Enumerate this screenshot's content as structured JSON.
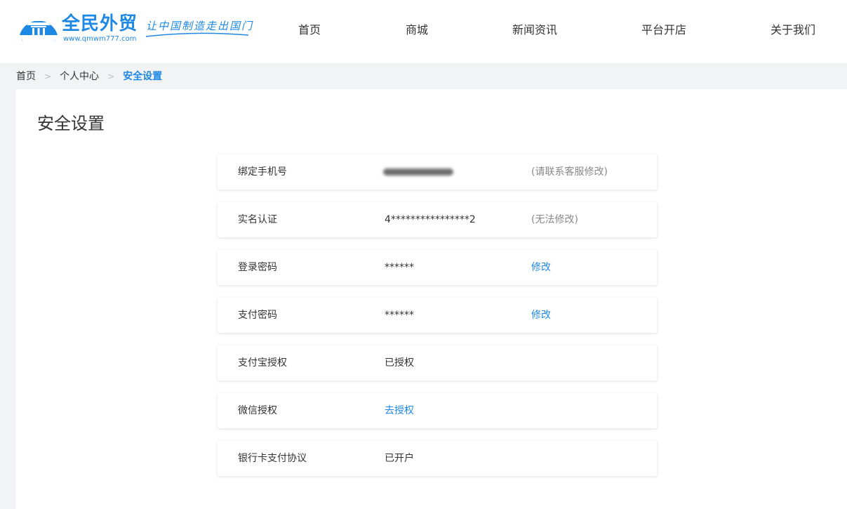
{
  "header": {
    "logo": {
      "title": "全民外贸",
      "url": "www.qmwm777.com",
      "slogan": "让中国制造走出国门"
    },
    "nav": [
      "首页",
      "商城",
      "新闻资讯",
      "平台开店",
      "关于我们"
    ]
  },
  "breadcrumb": {
    "items": [
      "首页",
      "个人中心"
    ],
    "current": "安全设置",
    "separator": ">"
  },
  "page": {
    "title": "安全设置"
  },
  "security": {
    "rows": [
      {
        "label": "绑定手机号",
        "value": "",
        "note": "(请联系客服修改)"
      },
      {
        "label": "实名认证",
        "value": "4****************2",
        "note": "(无法修改)"
      },
      {
        "label": "登录密码",
        "value": "******",
        "action": "修改"
      },
      {
        "label": "支付密码",
        "value": "******",
        "action": "修改"
      },
      {
        "label": "支付宝授权",
        "value": "已授权"
      },
      {
        "label": "微信授权",
        "link": "去授权"
      },
      {
        "label": "银行卡支付协议",
        "value": "已开户"
      }
    ]
  },
  "colors": {
    "accent": "#1e88e5",
    "page_bg": "#f2f3f5",
    "muted": "#888888"
  }
}
